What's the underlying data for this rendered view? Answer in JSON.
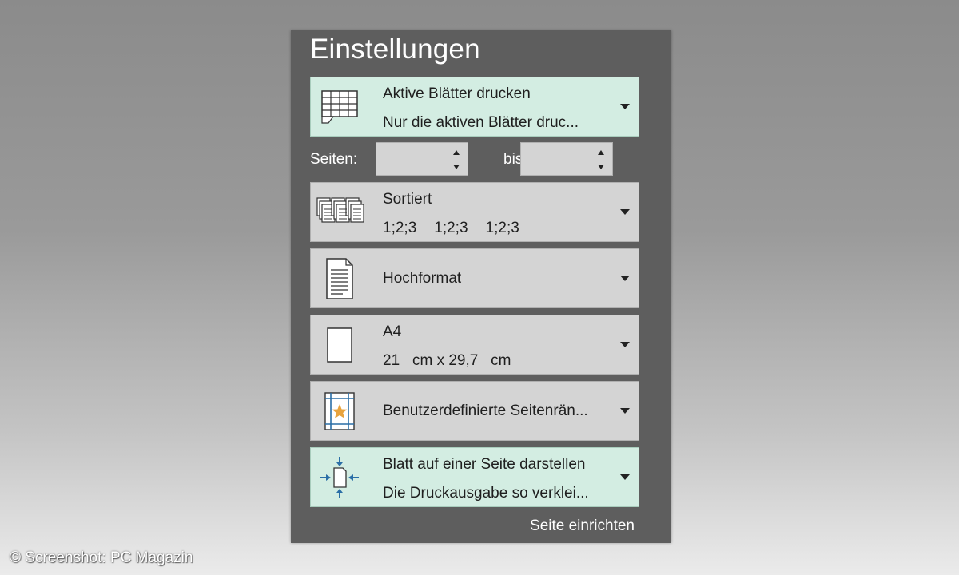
{
  "settings": {
    "title": "Einstellungen",
    "print_scope": {
      "line1": "Aktive Blätter drucken",
      "line2": "Nur die aktiven Blätter druc..."
    },
    "pages": {
      "label": "Seiten:",
      "from_value": "",
      "to_label": "bis",
      "to_value": ""
    },
    "collation": {
      "line1": "Sortiert",
      "line2": [
        "1;2;3",
        "1;2;3",
        "1;2;3"
      ]
    },
    "orientation": {
      "label": "Hochformat"
    },
    "paper": {
      "line1": "A4",
      "line2": "21   cm x 29,7   cm"
    },
    "margins": {
      "label": "Benutzerdefinierte Seitenrän..."
    },
    "scaling": {
      "line1": "Blatt auf einer Seite darstellen",
      "line2": "Die Druckausgabe so verklei..."
    },
    "page_setup_link": "Seite einrichten"
  },
  "credit": "© Screenshot: PC Magazin",
  "colors": {
    "panel": "#5e5e5e",
    "dropdown": "#d4d4d4",
    "dropdown_selected": "#d3ede2",
    "icon_blue": "#2a6ea6",
    "star": "#e8a33d"
  },
  "icons": {
    "print_scope": "sheet-grid-icon",
    "collation": "collated-pages-icon",
    "orientation": "portrait-page-icon",
    "paper": "blank-page-icon",
    "margins": "custom-margins-icon",
    "scaling": "fit-to-page-icon"
  }
}
